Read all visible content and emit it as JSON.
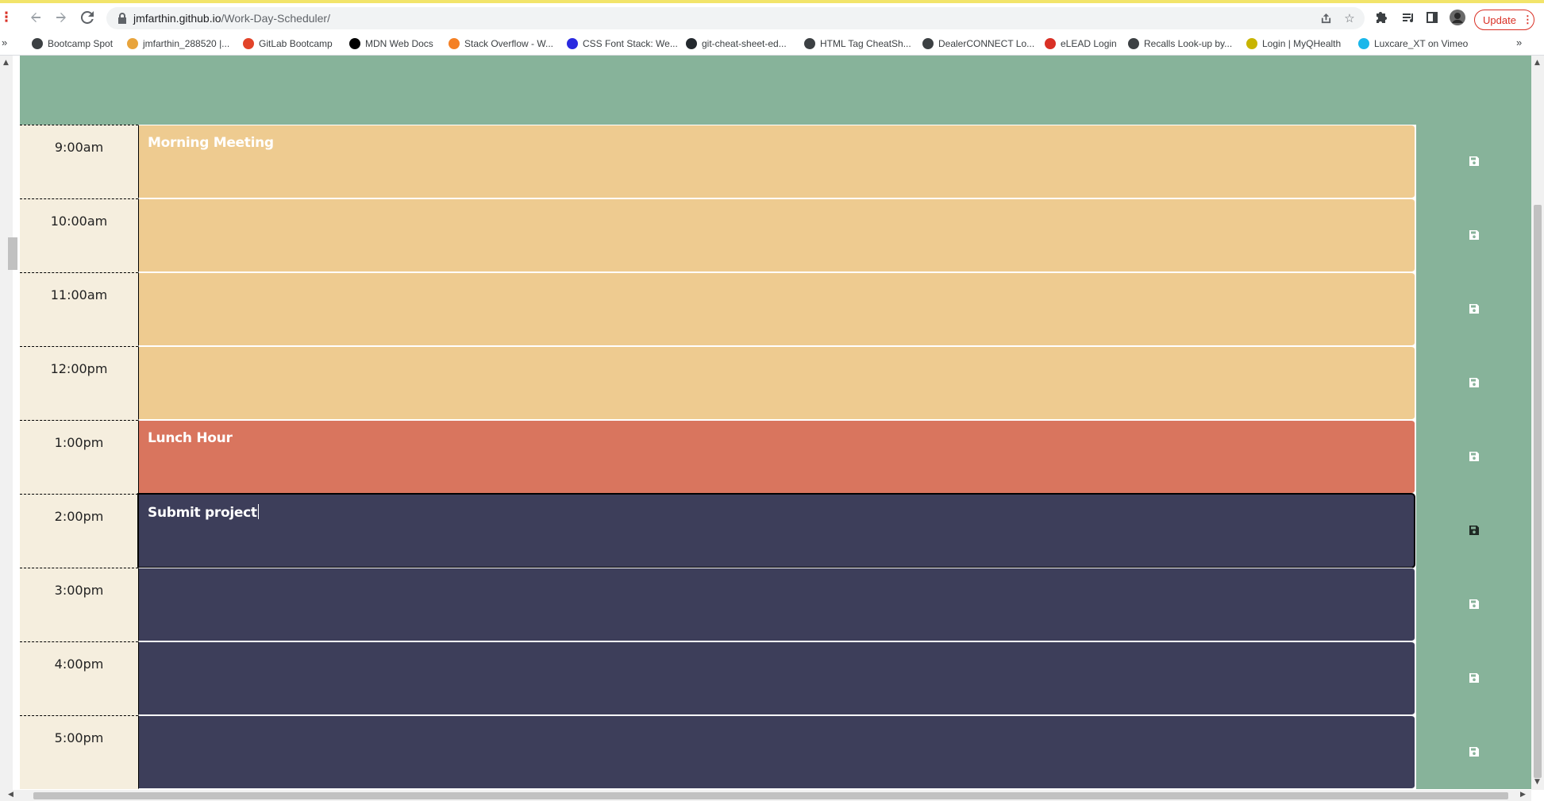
{
  "browser": {
    "url_host": "jmfarthin.github.io",
    "url_path": "/Work-Day-Scheduler/",
    "update_label": "Update",
    "update_dots": "⋮"
  },
  "bookmarks": [
    {
      "label": "Bootcamp Spot",
      "icon": "globe-icon",
      "color": "#3c4043"
    },
    {
      "label": "jmfarthin_288520 |...",
      "icon": "person-icon",
      "color": "#e8a43c"
    },
    {
      "label": "GitLab Bootcamp",
      "icon": "gitlab-icon",
      "color": "#e24329"
    },
    {
      "label": "MDN Web Docs",
      "icon": "mdn-icon",
      "color": "#000000"
    },
    {
      "label": "Stack Overflow - W...",
      "icon": "stackoverflow-icon",
      "color": "#f48024"
    },
    {
      "label": "CSS Font Stack: We...",
      "icon": "cssfont-icon",
      "color": "#2a2ae0"
    },
    {
      "label": "git-cheat-sheet-ed...",
      "icon": "github-icon",
      "color": "#24292e"
    },
    {
      "label": "HTML Tag CheatSh...",
      "icon": "globe-icon",
      "color": "#3c4043"
    },
    {
      "label": "DealerCONNECT Lo...",
      "icon": "globe-icon",
      "color": "#3c4043"
    },
    {
      "label": "eLEAD Login",
      "icon": "elead-icon",
      "color": "#d93025"
    },
    {
      "label": "Recalls Look-up by...",
      "icon": "globe-icon",
      "color": "#3c4043"
    },
    {
      "label": "Login | MyQHealth",
      "icon": "myq-icon",
      "color": "#c8b400"
    },
    {
      "label": "Luxcare_XT on Vimeo",
      "icon": "vimeo-icon",
      "color": "#1ab7ea"
    }
  ],
  "bookmarks_more": "»",
  "scheduler": {
    "rows": [
      {
        "hour": "9:00am",
        "text": "Morning Meeting",
        "state": "present"
      },
      {
        "hour": "10:00am",
        "text": "",
        "state": "present"
      },
      {
        "hour": "11:00am",
        "text": "",
        "state": "present"
      },
      {
        "hour": "12:00pm",
        "text": "",
        "state": "present"
      },
      {
        "hour": "1:00pm",
        "text": "Lunch Hour",
        "state": "past"
      },
      {
        "hour": "2:00pm",
        "text": "Submit project",
        "state": "future",
        "focused": true
      },
      {
        "hour": "3:00pm",
        "text": "",
        "state": "future"
      },
      {
        "hour": "4:00pm",
        "text": "",
        "state": "future"
      },
      {
        "hour": "5:00pm",
        "text": "",
        "state": "future"
      }
    ]
  },
  "colors": {
    "past": "#d9755e",
    "present": "#eecb90",
    "future": "#3d3e5a",
    "header": "#87b39a",
    "hour_bg": "#f5eede"
  }
}
